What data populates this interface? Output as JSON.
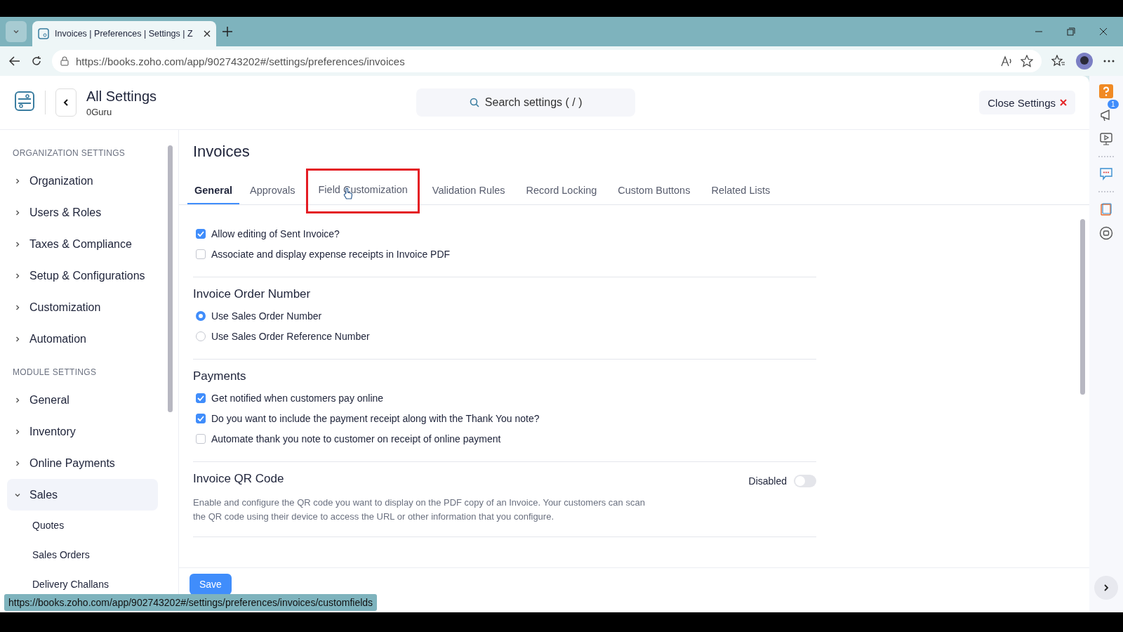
{
  "browser": {
    "tab_title": "Invoices | Preferences | Settings | Z",
    "url": "https://books.zoho.com/app/902743202#/settings/preferences/invoices",
    "status_url": "https://books.zoho.com/app/902743202#/settings/preferences/invoices/customfields"
  },
  "header": {
    "title": "All Settings",
    "org": "0Guru",
    "search_placeholder": "Search settings ( / )",
    "close_label": "Close Settings"
  },
  "sidebar": [
    {
      "heading": "ORGANIZATION SETTINGS",
      "items": [
        {
          "label": "Organization",
          "expanded": false,
          "selected": false
        },
        {
          "label": "Users & Roles",
          "expanded": false,
          "selected": false
        },
        {
          "label": "Taxes & Compliance",
          "expanded": false,
          "selected": false
        },
        {
          "label": "Setup & Configurations",
          "expanded": false,
          "selected": false
        },
        {
          "label": "Customization",
          "expanded": false,
          "selected": false
        },
        {
          "label": "Automation",
          "expanded": false,
          "selected": false
        }
      ]
    },
    {
      "heading": "MODULE SETTINGS",
      "items": [
        {
          "label": "General",
          "expanded": false,
          "selected": false
        },
        {
          "label": "Inventory",
          "expanded": false,
          "selected": false
        },
        {
          "label": "Online Payments",
          "expanded": false,
          "selected": false
        },
        {
          "label": "Sales",
          "expanded": true,
          "selected": true,
          "children": [
            {
              "label": "Quotes"
            },
            {
              "label": "Sales Orders"
            },
            {
              "label": "Delivery Challans"
            }
          ]
        }
      ]
    }
  ],
  "page_title": "Invoices",
  "tabs": [
    {
      "label": "General",
      "selected": true,
      "highlighted": false
    },
    {
      "label": "Approvals",
      "selected": false,
      "highlighted": false
    },
    {
      "label": "Field Customization",
      "selected": false,
      "highlighted": true
    },
    {
      "label": "Validation Rules",
      "selected": false,
      "highlighted": false
    },
    {
      "label": "Record Locking",
      "selected": false,
      "highlighted": false
    },
    {
      "label": "Custom Buttons",
      "selected": false,
      "highlighted": false
    },
    {
      "label": "Related Lists",
      "selected": false,
      "highlighted": false
    }
  ],
  "sections": [
    {
      "options": [
        {
          "kind": "checkbox",
          "label": "Allow editing of Sent Invoice?",
          "checked": true
        },
        {
          "kind": "checkbox",
          "label": "Associate and display expense receipts in Invoice PDF",
          "checked": false
        }
      ]
    },
    {
      "heading": "Invoice Order Number",
      "options": [
        {
          "kind": "radio",
          "label": "Use Sales Order Number",
          "checked": true
        },
        {
          "kind": "radio",
          "label": "Use Sales Order Reference Number",
          "checked": false
        }
      ]
    },
    {
      "heading": "Payments",
      "options": [
        {
          "kind": "checkbox",
          "label": "Get notified when customers pay online",
          "checked": true
        },
        {
          "kind": "checkbox",
          "label": "Do you want to include the payment receipt along with the Thank You note?",
          "checked": true
        },
        {
          "kind": "checkbox",
          "label": "Automate thank you note to customer on receipt of online payment",
          "checked": false
        }
      ]
    },
    {
      "heading": "Invoice QR Code",
      "toggle": {
        "label": "Disabled",
        "on": false
      },
      "description": "Enable and configure the QR code you want to display on the PDF copy of an Invoice. Your customers can scan the QR code using their device to access the URL or other information that you configure."
    }
  ],
  "save_label": "Save",
  "rail_badge": "1"
}
